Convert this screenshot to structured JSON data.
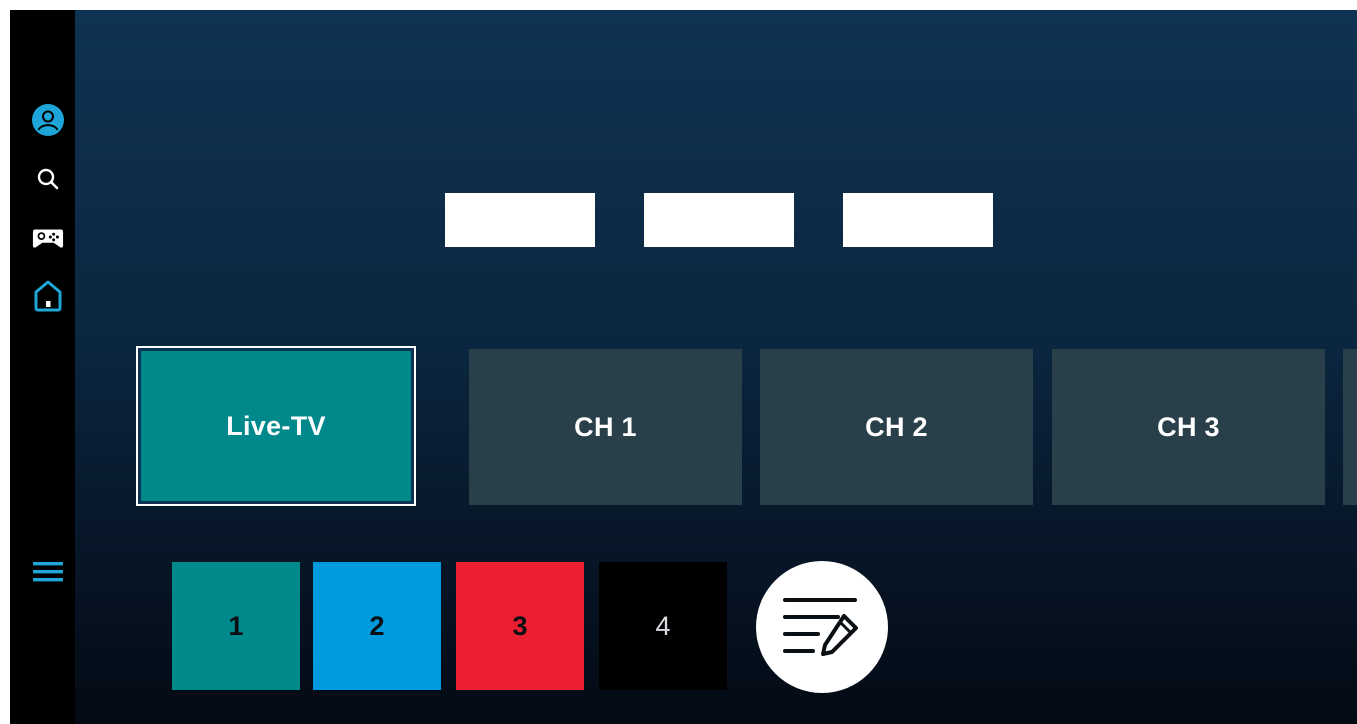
{
  "sidebar": {
    "items": [
      {
        "name": "profile",
        "icon": "profile-icon"
      },
      {
        "name": "search",
        "icon": "search-icon"
      },
      {
        "name": "games",
        "icon": "gamepad-icon"
      },
      {
        "name": "home",
        "icon": "home-icon",
        "selected": true
      },
      {
        "name": "menu",
        "icon": "hamburger-menu-icon"
      }
    ],
    "accent_color": "#1fa6d9"
  },
  "channels": {
    "live_label": "Live-TV",
    "items": [
      {
        "label": "CH 1"
      },
      {
        "label": "CH 2"
      },
      {
        "label": "CH 3"
      }
    ]
  },
  "color_keys": [
    {
      "label": "1",
      "color": "#008a8c"
    },
    {
      "label": "2",
      "color": "#009bde"
    },
    {
      "label": "3",
      "color": "#ec1e31"
    },
    {
      "label": "4",
      "color": "#000000"
    }
  ],
  "edit_button": {
    "icon": "edit-list-icon"
  },
  "colors": {
    "focused_tile": "#00888b",
    "tile": "#29404a",
    "background_top": "#0f3353",
    "background_bottom": "#030a14"
  }
}
